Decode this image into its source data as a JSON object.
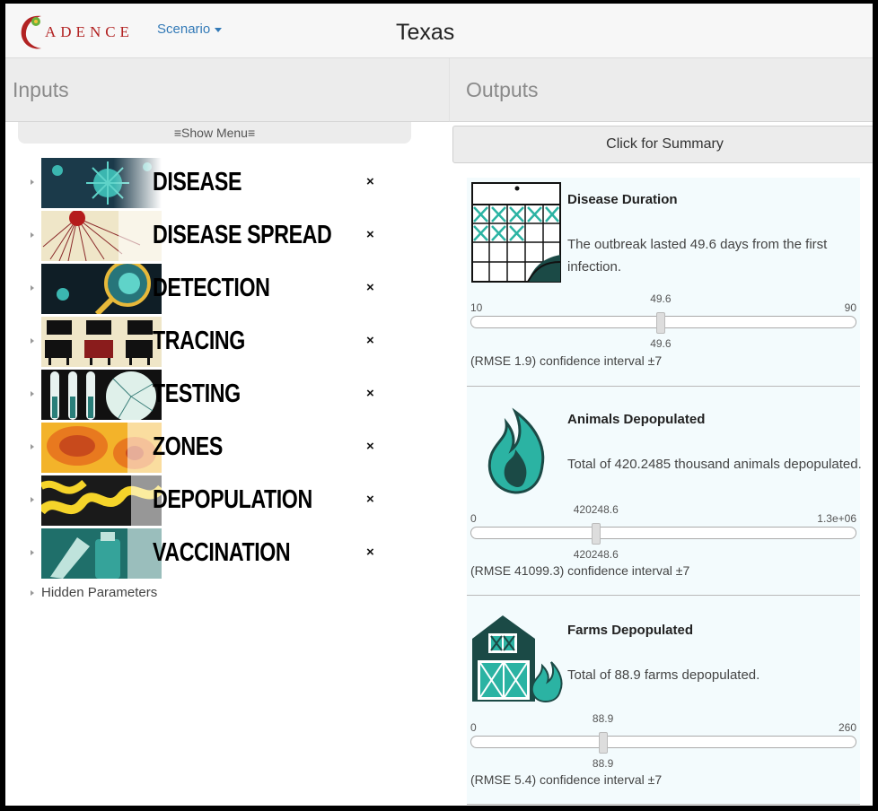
{
  "header": {
    "logo_text": "ADENCE",
    "scenario_label": "Scenario",
    "title": "Texas"
  },
  "inputs_panel": {
    "heading": "Inputs",
    "show_menu": "≡Show Menu≡",
    "items": [
      {
        "label": "DISEASE",
        "remove": "×"
      },
      {
        "label": "DISEASE SPREAD",
        "remove": "×"
      },
      {
        "label": "DETECTION",
        "remove": "×"
      },
      {
        "label": "TRACING",
        "remove": "×"
      },
      {
        "label": "TESTING",
        "remove": "×"
      },
      {
        "label": "ZONES",
        "remove": "×"
      },
      {
        "label": "DEPOPULATION",
        "remove": "×"
      },
      {
        "label": "VACCINATION",
        "remove": "×"
      }
    ],
    "hidden_parameters": "Hidden Parameters"
  },
  "outputs_panel": {
    "heading": "Outputs",
    "summary_button": "Click for Summary",
    "cards": [
      {
        "title": "Disease Duration",
        "description": "The outbreak lasted 49.6 days from the first infection.",
        "slider": {
          "min": 10,
          "max": 90,
          "value": 49.6,
          "min_label": "10",
          "max_label": "90",
          "value_label": "49.6"
        },
        "rmse": "(RMSE 1.9) confidence interval ±7"
      },
      {
        "title": "Animals Depopulated",
        "description": "Total of 420.2485 thousand animals depopulated.",
        "slider": {
          "min": 0,
          "max": 1300000,
          "value": 420248.6,
          "min_label": "0",
          "max_label": "1.3e+06",
          "value_label": "420248.6"
        },
        "rmse": "(RMSE 41099.3) confidence interval ±7"
      },
      {
        "title": "Farms Depopulated",
        "description": "Total of 88.9 farms depopulated.",
        "slider": {
          "min": 0,
          "max": 260,
          "value": 88.9,
          "min_label": "0",
          "max_label": "260",
          "value_label": "88.9"
        },
        "rmse": "(RMSE 5.4) confidence interval ±7"
      }
    ]
  },
  "colors": {
    "brand_red": "#b22222",
    "link_blue": "#337ab7",
    "teal": "#1f8f85",
    "dark_green": "#1b4a46"
  },
  "icons": [
    "logo-icon",
    "calendar-icon",
    "fire-icon",
    "barn-fire-icon",
    "virus-image",
    "spread-image",
    "magnifier-image",
    "cattle-image",
    "test-tubes-image",
    "zones-image",
    "depopulation-image",
    "vaccination-image"
  ]
}
